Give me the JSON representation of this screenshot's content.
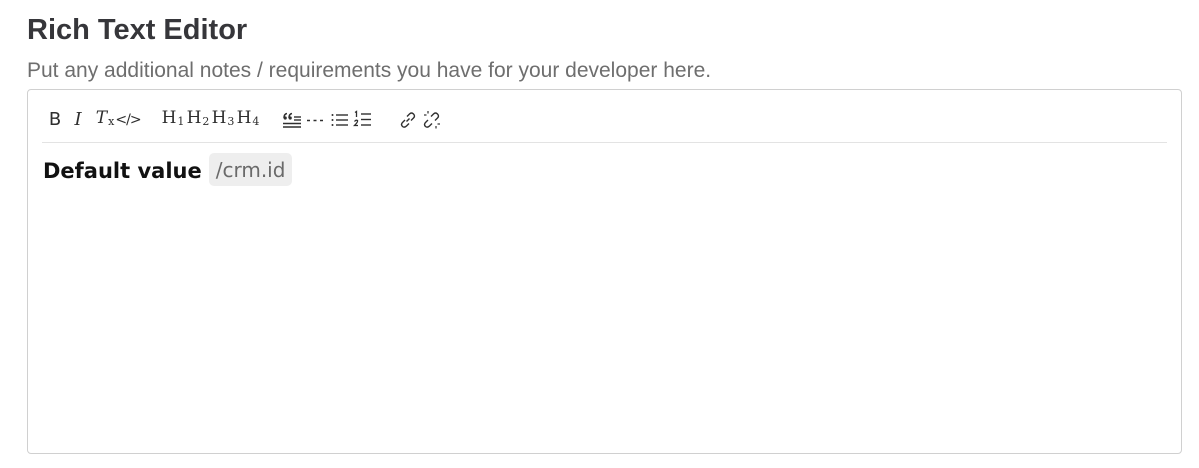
{
  "page": {
    "title": "Rich Text Editor",
    "subtitle": "Put any additional notes / requirements you have for your developer here."
  },
  "toolbar": {
    "bold_label": "B",
    "italic_label": "I",
    "clear_format_label": "T",
    "clear_format_sub": "x",
    "code_label": "</>",
    "h1_label": "H",
    "h1_sub": "1",
    "h2_label": "H",
    "h2_sub": "2",
    "h3_label": "H",
    "h3_sub": "3",
    "h4_label": "H",
    "h4_sub": "4",
    "icons": [
      "bold-icon",
      "italic-icon",
      "clear-format-icon",
      "code-icon",
      "heading-1-icon",
      "heading-2-icon",
      "heading-3-icon",
      "heading-4-icon",
      "blockquote-icon",
      "horizontal-rule-icon",
      "bullet-list-icon",
      "ordered-list-icon",
      "link-icon",
      "unlink-icon"
    ]
  },
  "editor": {
    "bold_text": "Default value",
    "inline_code": "/crm.id"
  },
  "colors": {
    "title": "#36363a",
    "subtitle": "#6e6e6e",
    "border": "#d0d0d0",
    "code_background": "#eeeeee",
    "code_text": "#6a6a6a"
  }
}
